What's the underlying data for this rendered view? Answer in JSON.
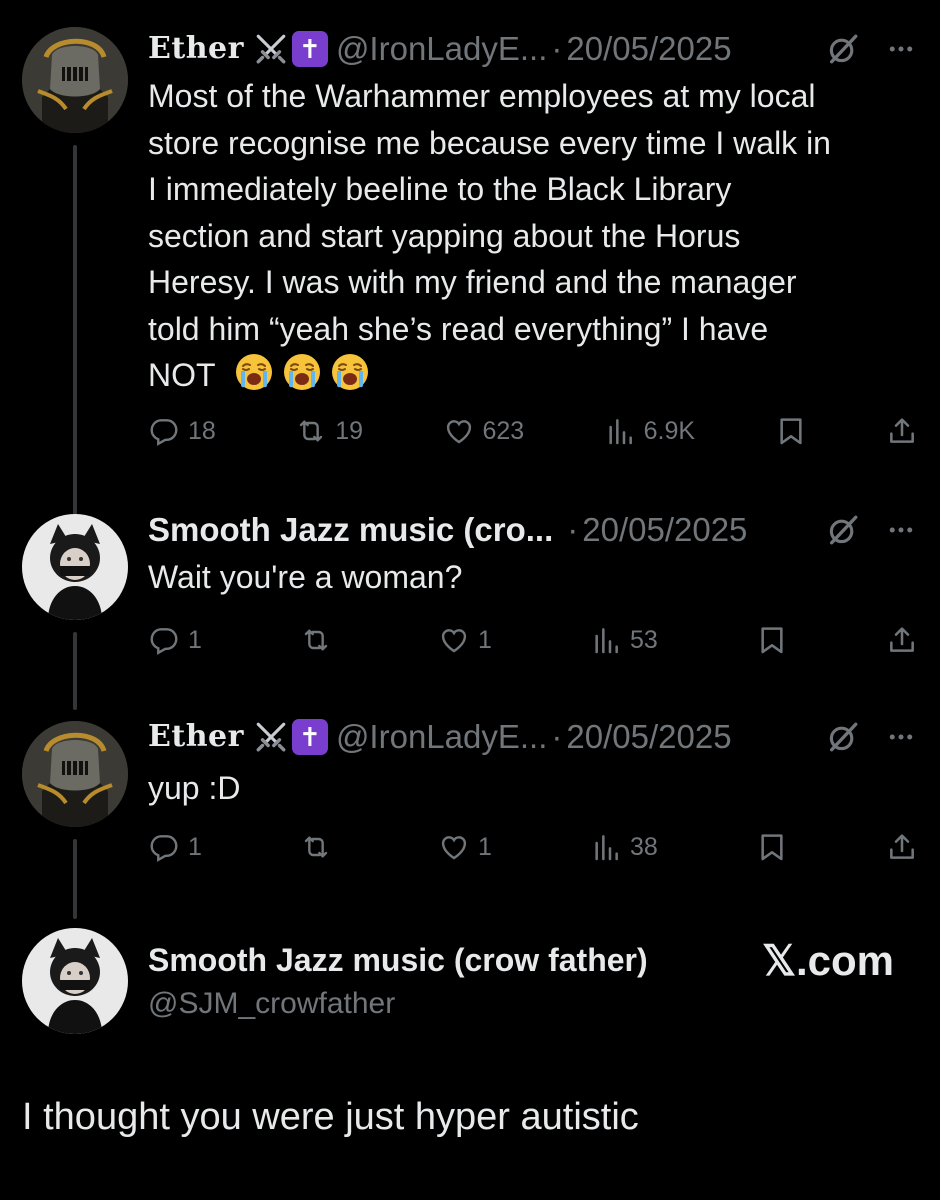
{
  "tweets": [
    {
      "name": "Ether",
      "handle": "@IronLadyE...",
      "date": "20/05/2025",
      "text_lines": [
        "Most of the Warhammer employees at my local",
        "store recognise me because every time I walk in",
        "I immediately beeline to the Black Library",
        "section and start yapping about the Horus",
        "Heresy. I was with my friend and the manager",
        "told him “yeah she’s read everything” I have",
        "NOT"
      ],
      "stats": {
        "replies": "18",
        "reposts": "19",
        "likes": "623",
        "views": "6.9K"
      }
    },
    {
      "name": "Smooth Jazz music (cro...",
      "date": "20/05/2025",
      "text": "Wait you're a woman?",
      "stats": {
        "replies": "1",
        "reposts": "",
        "likes": "1",
        "views": "53"
      }
    },
    {
      "name": "Ether",
      "handle": "@IronLadyE...",
      "date": "20/05/2025",
      "text": "yup :D",
      "stats": {
        "replies": "1",
        "reposts": "",
        "likes": "1",
        "views": "38"
      }
    }
  ],
  "quote": {
    "name": "Smooth Jazz music (crow father)",
    "handle": "@SJM_crowfather",
    "source": "𝕏.com",
    "text": "I thought you were just hyper autistic"
  },
  "separator": "·",
  "cross_glyph": "✝",
  "icons": [
    "reply-icon",
    "repost-icon",
    "like-icon",
    "views-icon",
    "bookmark-icon",
    "share-icon",
    "grok-icon",
    "more-icon",
    "crossed-swords-icon",
    "latin-cross-icon",
    "loudly-crying-face-icon"
  ],
  "colors": {
    "background": "#000000",
    "text": "#e7e9ea",
    "muted": "#71767b",
    "thread_line": "#333639",
    "cross_bg": "#7a3ecf"
  }
}
